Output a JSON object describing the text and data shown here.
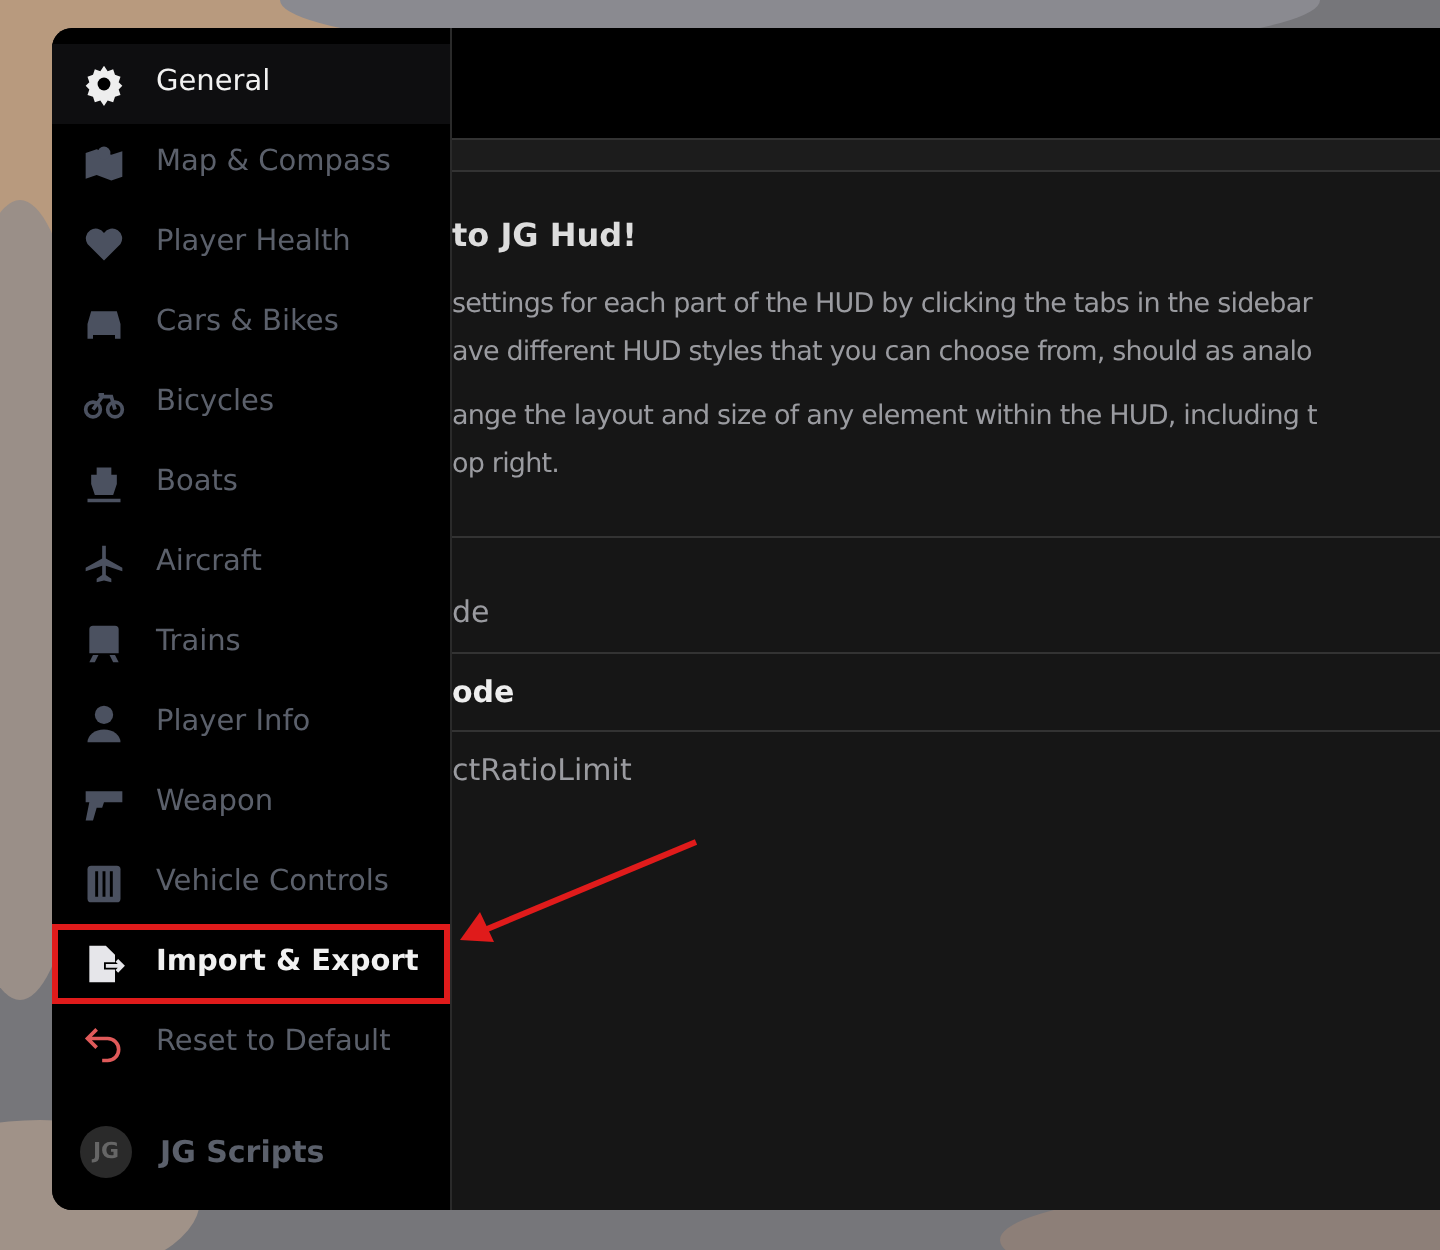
{
  "sidebar": {
    "items": [
      {
        "label": "General",
        "selected": true,
        "highlighted": false
      },
      {
        "label": "Map & Compass",
        "selected": false,
        "highlighted": false
      },
      {
        "label": "Player Health",
        "selected": false,
        "highlighted": false
      },
      {
        "label": "Cars & Bikes",
        "selected": false,
        "highlighted": false
      },
      {
        "label": "Bicycles",
        "selected": false,
        "highlighted": false
      },
      {
        "label": "Boats",
        "selected": false,
        "highlighted": false
      },
      {
        "label": "Aircraft",
        "selected": false,
        "highlighted": false
      },
      {
        "label": "Trains",
        "selected": false,
        "highlighted": false
      },
      {
        "label": "Player Info",
        "selected": false,
        "highlighted": false
      },
      {
        "label": "Weapon",
        "selected": false,
        "highlighted": false
      },
      {
        "label": "Vehicle Controls",
        "selected": false,
        "highlighted": false
      },
      {
        "label": "Import & Export",
        "selected": false,
        "highlighted": true
      },
      {
        "label": "Reset to Default",
        "selected": false,
        "highlighted": false
      }
    ],
    "footer": {
      "avatar": "JG",
      "name": "JG Scripts"
    }
  },
  "content": {
    "title": "to JG Hud!",
    "paragraphs": [
      [
        "settings for each part of the HUD by clicking the tabs in the sidebar",
        "ave different HUD styles that you can choose from, should as analo"
      ],
      [
        "ange the layout and size of any element within the HUD, including t",
        "op right."
      ]
    ],
    "rows": [
      {
        "label": "de",
        "selected": false
      },
      {
        "label": "ode",
        "selected": true
      },
      {
        "label": "ctRatioLimit",
        "selected": false
      }
    ]
  },
  "annotation_arrow": true
}
